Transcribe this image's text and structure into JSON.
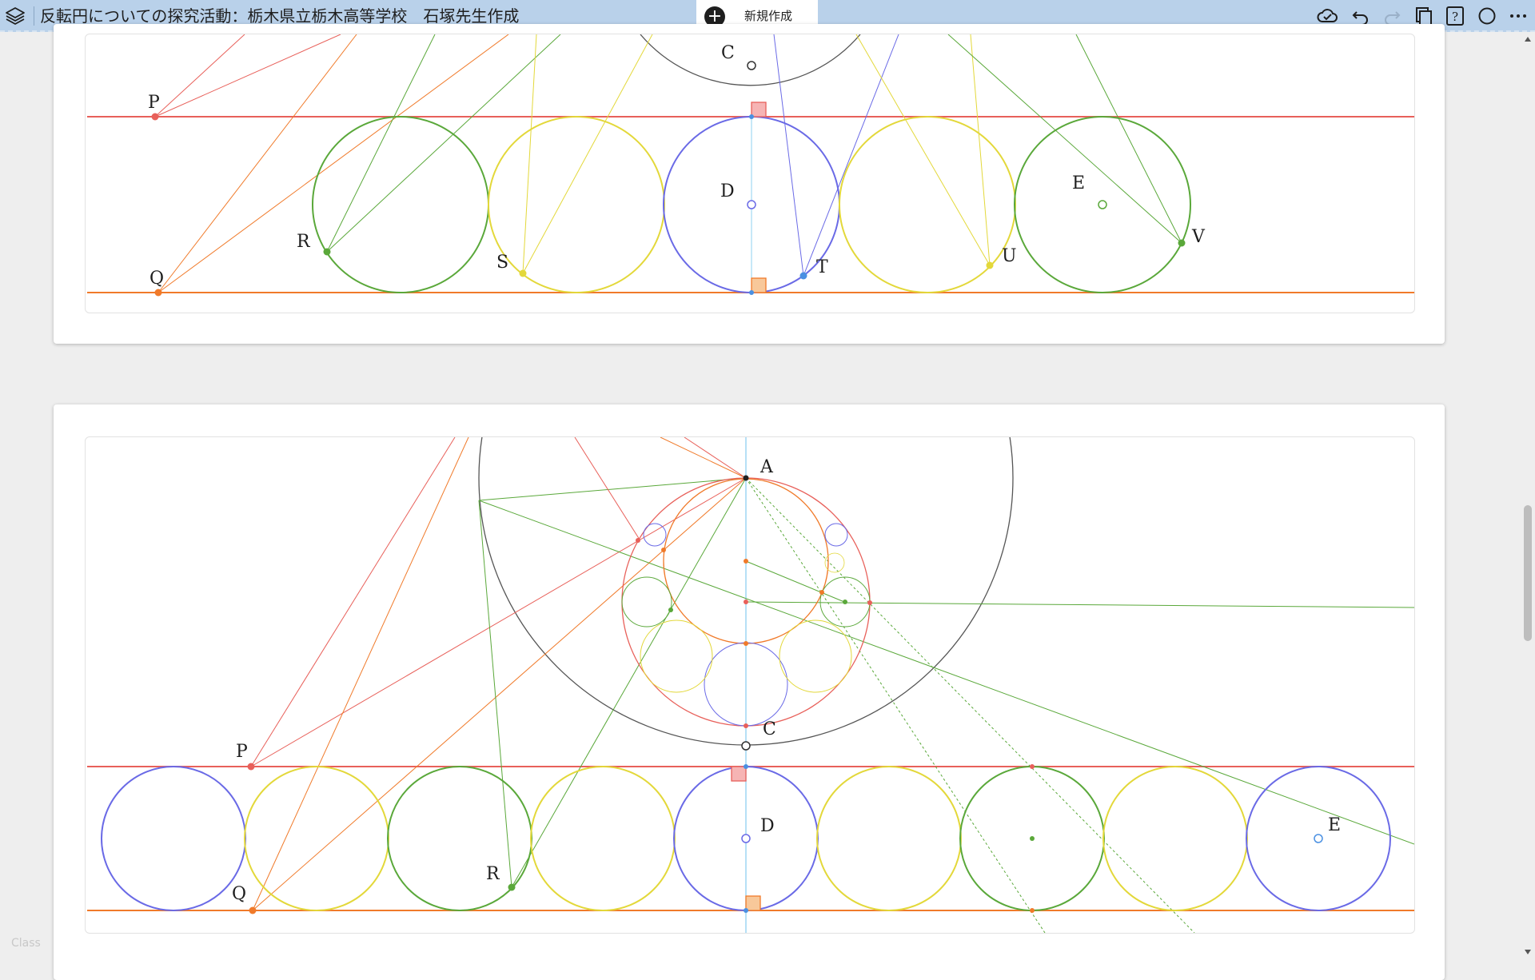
{
  "app": {
    "title": "反転円についての探究活動：栃木県立栃木高等学校　石塚先生作成",
    "new_tab_label": "新規作成",
    "watermark": "Class"
  },
  "toolbar": {
    "icons": [
      "cloud-sync-icon",
      "undo-icon",
      "redo-icon",
      "duplicate-icon",
      "help-icon",
      "circle-tool-icon",
      "more-icon"
    ]
  },
  "figure1": {
    "labels": {
      "C": "C",
      "P": "P",
      "Q": "Q",
      "R": "R",
      "S": "S",
      "D": "D",
      "T": "T",
      "U": "U",
      "E": "E",
      "V": "V"
    }
  },
  "figure2": {
    "labels": {
      "A": "A",
      "C": "C",
      "P": "P",
      "Q": "Q",
      "R": "R",
      "D": "D",
      "E": "E"
    }
  },
  "colors": {
    "red": "#e8605a",
    "orange": "#f07a2a",
    "green": "#5aa83a",
    "yellow": "#e3d83a",
    "blue": "#6a6ae6",
    "black": "#555555",
    "cyan": "#8fd0f0"
  }
}
